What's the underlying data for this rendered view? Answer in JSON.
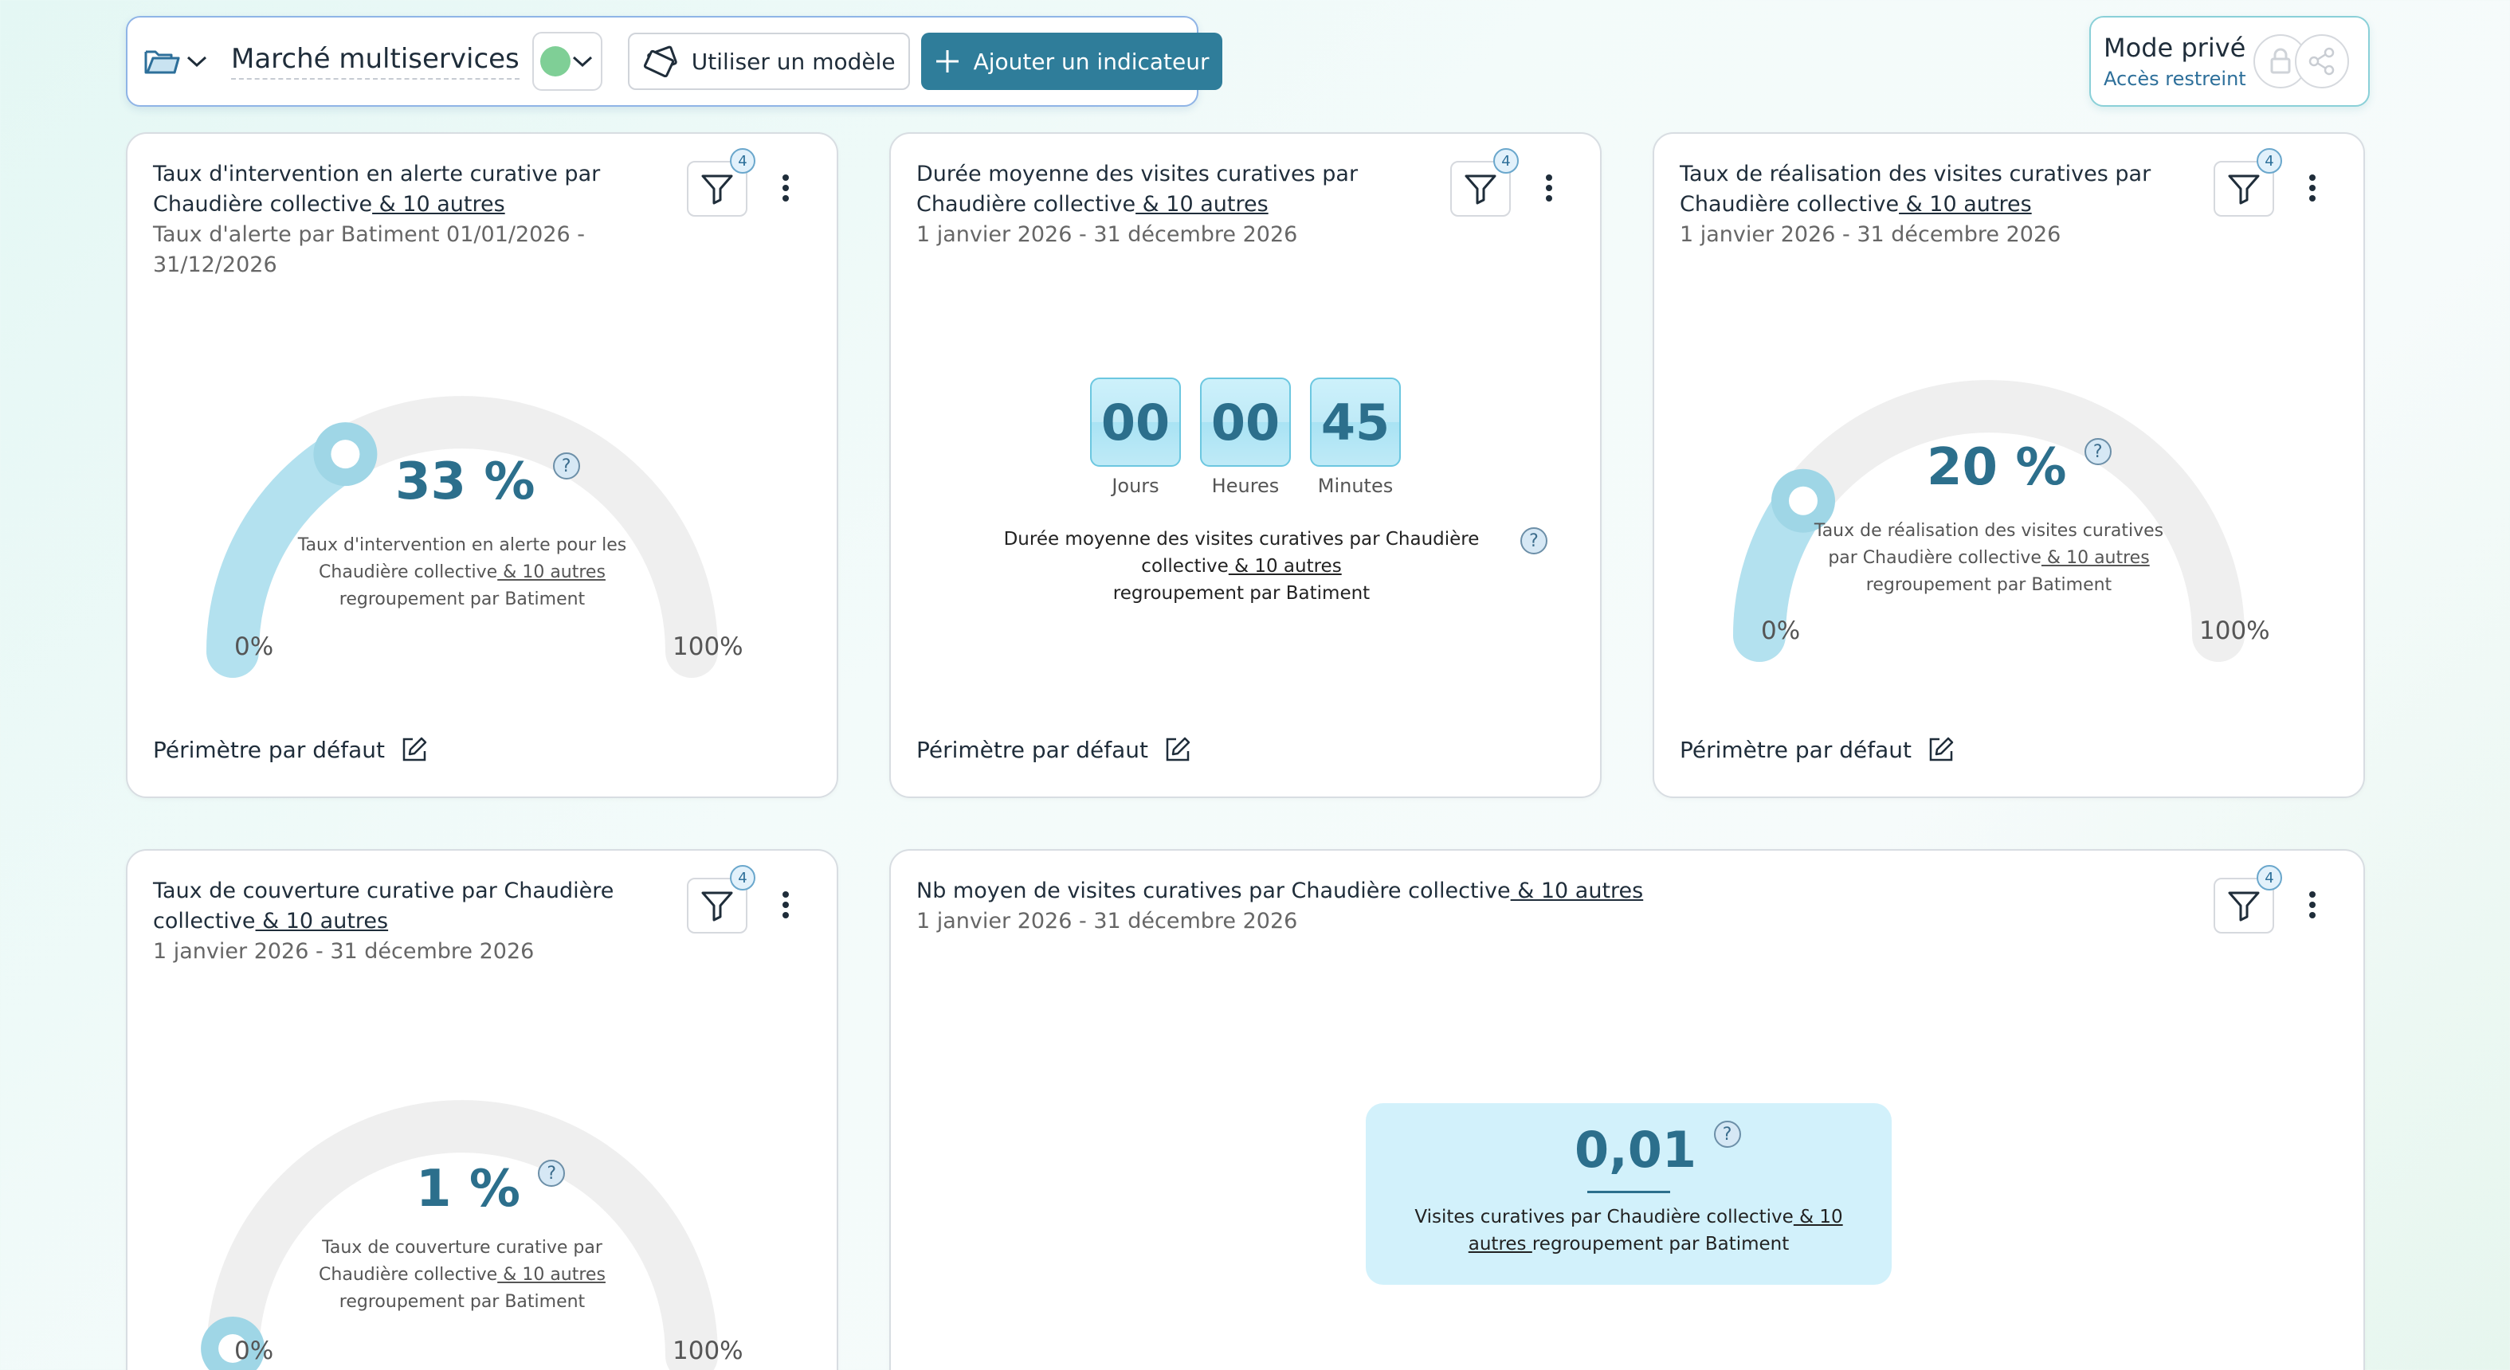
{
  "toolbar": {
    "title": "Marché multiservices",
    "template_label": "Utiliser un modèle",
    "add_label": "Ajouter un indicateur",
    "status_color": "#7fcf96"
  },
  "privacy": {
    "mode": "Mode privé",
    "access": "Accès restreint"
  },
  "cards": {
    "c1": {
      "title": "Taux d'intervention en alerte curative par Chaudière collective",
      "link": " & 10 autres",
      "subtitle": "Taux d'alerte par Batiment 01/01/2026 - 31/12/2026",
      "filter_count": "4",
      "value": "33 %",
      "value_fraction": 0.33,
      "desc_line1": "Taux d'intervention en alerte pour les",
      "desc_line2": "Chaudière collective",
      "desc_link": " & 10 autres",
      "desc_line3": "regroupement par Batiment",
      "min": "0%",
      "max": "100%",
      "footer": "Périmètre par défaut"
    },
    "c2": {
      "title": "Durée moyenne des visites curatives par Chaudière collective",
      "link": " & 10 autres",
      "subtitle": "1 janvier 2026 - 31 décembre 2026",
      "filter_count": "4",
      "days": "00",
      "hours": "00",
      "minutes": "45",
      "days_label": "Jours",
      "hours_label": "Heures",
      "minutes_label": "Minutes",
      "desc_line1": "Durée moyenne des visites curatives par Chaudière",
      "desc_line2": "collective",
      "desc_link": " & 10 autres",
      "desc_line3": "regroupement par Batiment",
      "footer": "Périmètre par défaut"
    },
    "c3": {
      "title": "Taux de réalisation des visites curatives par Chaudière collective",
      "link": " & 10 autres",
      "subtitle": "1 janvier 2026 - 31 décembre 2026",
      "filter_count": "4",
      "value": "20 %",
      "value_fraction": 0.2,
      "desc_line1": "Taux de réalisation des visites curatives",
      "desc_line2": "par Chaudière collective",
      "desc_link": " & 10 autres",
      "desc_line3": "regroupement par Batiment",
      "min": "0%",
      "max": "100%",
      "footer": "Périmètre par défaut"
    },
    "c4": {
      "title": "Taux de couverture curative par Chaudière collective",
      "link": " & 10 autres",
      "subtitle": "1 janvier 2026 - 31 décembre 2026",
      "filter_count": "4",
      "value": "1 %",
      "value_fraction": 0.01,
      "desc_line1": "Taux de couverture curative par",
      "desc_line2": "Chaudière collective",
      "desc_link": " & 10 autres",
      "desc_line3": "regroupement par Batiment",
      "min": "0%",
      "max": "100%"
    },
    "c5": {
      "title": "Nb moyen de visites curatives par Chaudière collective",
      "link": " & 10 autres",
      "subtitle": "1 janvier 2026 - 31 décembre 2026",
      "filter_count": "4",
      "value": "0,01",
      "desc_line1": "Visites curatives par Chaudière collective",
      "desc_link1": " & 10",
      "desc_link2": "autres ",
      "desc_line2": " regroupement par Batiment"
    }
  },
  "colors": {
    "accent": "#2f7d9a",
    "gauge_fill": "#b3e1ef",
    "gauge_track": "#efefef",
    "knob": "#9fd6e6"
  }
}
